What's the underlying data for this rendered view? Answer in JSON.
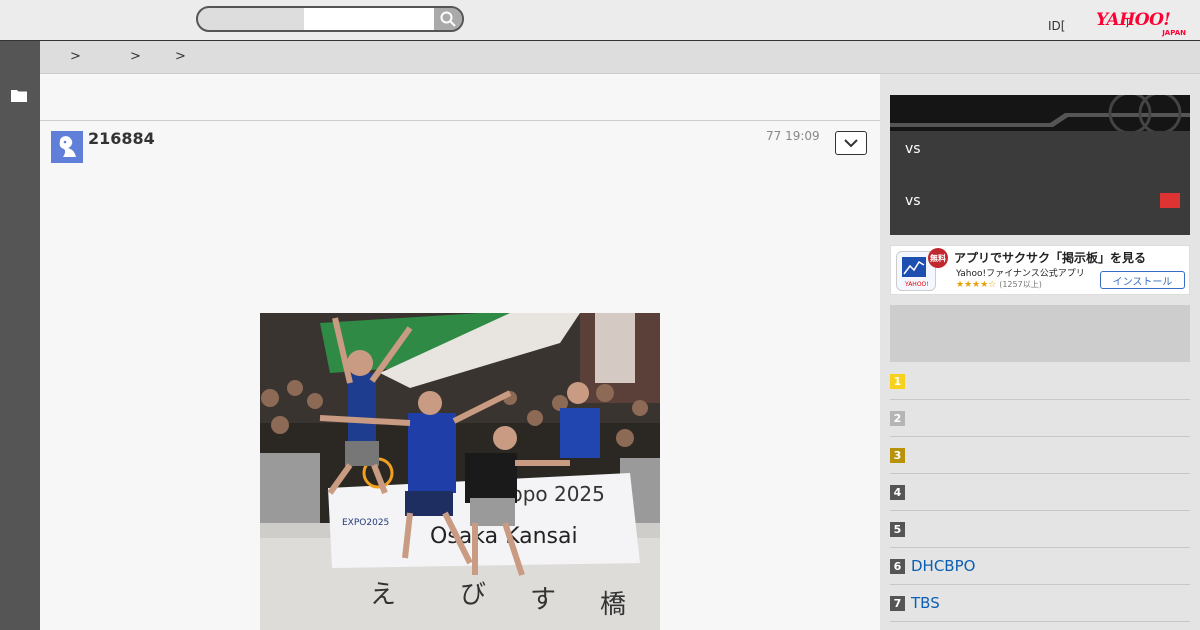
{
  "header": {
    "search": {
      "value": "",
      "placeholder": ""
    },
    "id_label": "ID[",
    "id_suffix": "]",
    "logo": {
      "main": "YAHOO!",
      "sub": "JAPAN"
    }
  },
  "breadcrumb": [
    ">",
    ">",
    ">"
  ],
  "post": {
    "author_id": "216884",
    "time": "77 19:09"
  },
  "sidebar": {
    "score_rows": [
      "vs",
      "vs"
    ],
    "ad": {
      "badge": "無料",
      "title": "アプリでサクサク「掲示板」を見る",
      "subtitle": "Yahoo!ファイナンス公式アプリ",
      "stars": "★★★★☆",
      "rating_count": "(1257以上)",
      "install_label": "インストール"
    },
    "ranking": [
      {
        "num": "1",
        "label": "",
        "color": "#f6d21f"
      },
      {
        "num": "2",
        "label": "",
        "color": "#b5b5b5"
      },
      {
        "num": "3",
        "label": "",
        "color": "#b8920c"
      },
      {
        "num": "4",
        "label": "",
        "color": "#555555"
      },
      {
        "num": "5",
        "label": "",
        "color": "#555555"
      },
      {
        "num": "6",
        "label": "DHCBPO",
        "color": "#555555"
      },
      {
        "num": "7",
        "label": "TBS",
        "color": "#555555"
      }
    ]
  },
  "colors": {
    "accent": "#ff0033",
    "link": "#0b5fb4",
    "rail": "#555555"
  },
  "icons": [
    "search-icon",
    "folder-icon",
    "chevron-down-icon",
    "avatar-icon",
    "app-icon"
  ]
}
